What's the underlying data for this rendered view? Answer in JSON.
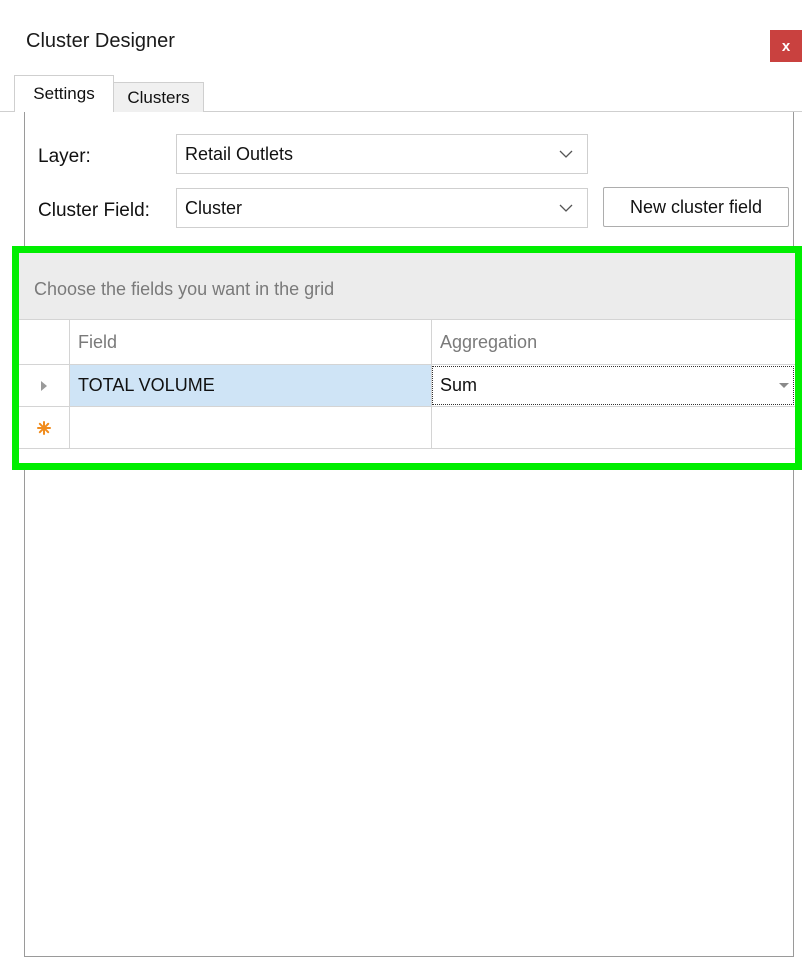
{
  "window": {
    "title": "Cluster Designer",
    "close_label": "x"
  },
  "tabs": [
    {
      "label": "Settings",
      "active": true
    },
    {
      "label": "Clusters",
      "active": false
    }
  ],
  "form": {
    "layer_label": "Layer:",
    "layer_value": "Retail Outlets",
    "cluster_field_label": "Cluster Field:",
    "cluster_field_value": "Cluster",
    "new_cluster_field_label": "New cluster field"
  },
  "grid": {
    "group_panel_text": "Choose the fields you want in the grid",
    "columns": [
      "Field",
      "Aggregation"
    ],
    "rows": [
      {
        "field": "TOTAL VOLUME",
        "aggregation": "Sum"
      }
    ],
    "new_row": {
      "field": "",
      "aggregation": ""
    }
  },
  "colors": {
    "highlight": "#00ee00",
    "close_button": "#c9413f",
    "selected_cell": "#cfe4f6",
    "new_row_indicator": "#f08c1e"
  },
  "icons": {
    "row_indicator": "current-row-triangle-icon",
    "new_row_indicator": "new-row-asterisk-icon",
    "dropdown": "chevron-down-icon"
  }
}
